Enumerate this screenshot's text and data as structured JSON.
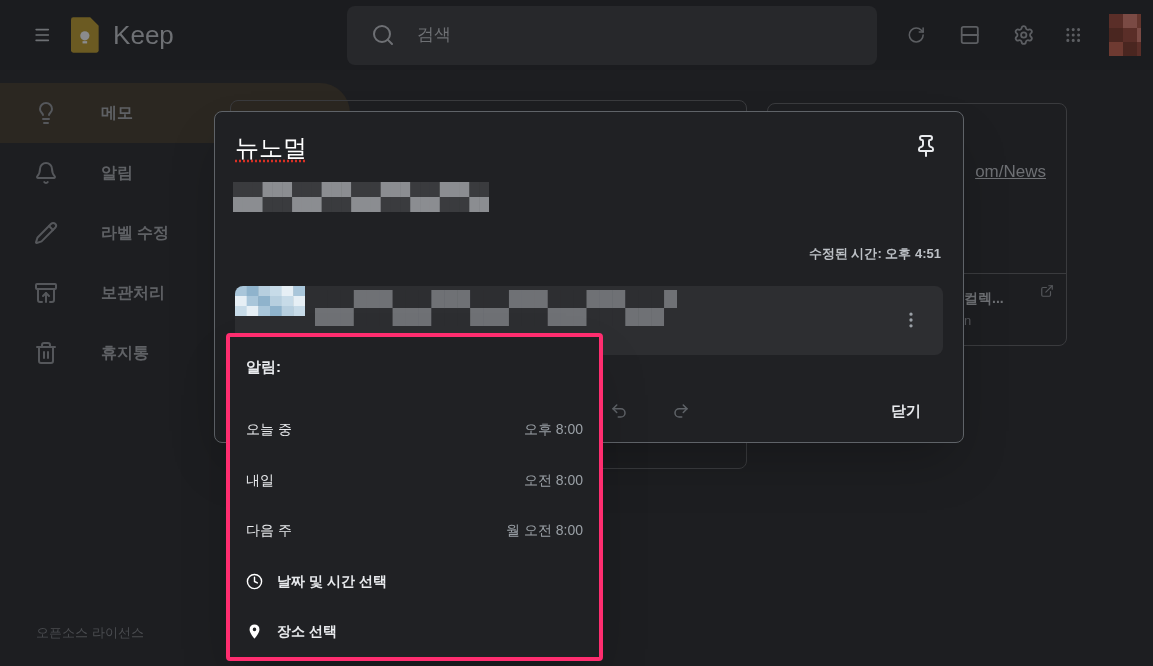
{
  "header": {
    "app_name": "Keep",
    "search": {
      "placeholder": "검색"
    }
  },
  "sidebar": {
    "items": [
      {
        "label": "메모",
        "selected": true
      },
      {
        "label": "알림",
        "selected": false
      },
      {
        "label": "라벨 수정",
        "selected": false
      },
      {
        "label": "보관처리",
        "selected": false
      },
      {
        "label": "휴지통",
        "selected": false
      }
    ],
    "footer_link": "오픈소스 라이선스"
  },
  "background_note": {
    "link_text": "om/News",
    "preview_title": "컬렉...",
    "preview_domain": "n"
  },
  "note": {
    "title": "뉴노멀",
    "modified": "수정된 시간: 오후 4:51",
    "close_button": "닫기"
  },
  "reminder_menu": {
    "title": "알림:",
    "items": [
      {
        "kind": "preset",
        "label": "오늘 중",
        "time": "오후 8:00"
      },
      {
        "kind": "preset",
        "label": "내일",
        "time": "오전 8:00"
      },
      {
        "kind": "preset",
        "label": "다음 주",
        "time": "월 오전 8:00"
      },
      {
        "kind": "datetime",
        "label": "날짜 및 시간 선택"
      },
      {
        "kind": "place",
        "label": "장소 선택"
      }
    ]
  }
}
